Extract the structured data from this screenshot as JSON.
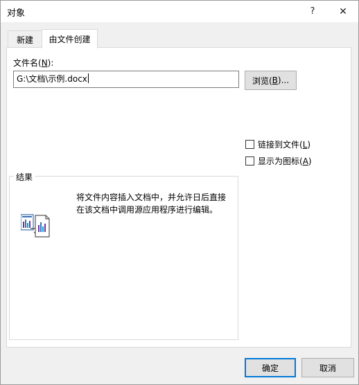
{
  "window": {
    "title": "对象",
    "help_glyph": "?",
    "close_glyph": "✕"
  },
  "tabs": [
    {
      "label": "新建",
      "selected": false
    },
    {
      "label": "由文件创建",
      "selected": true
    }
  ],
  "file": {
    "label_prefix": "文件名(",
    "label_key": "N",
    "label_suffix": "):",
    "value": "G:\\文档\\示例.docx",
    "browse_prefix": "浏览(",
    "browse_key": "B",
    "browse_suffix": ")..."
  },
  "options": {
    "link": {
      "prefix": "链接到文件(",
      "key": "L",
      "suffix": ")",
      "checked": false
    },
    "display_icon": {
      "prefix": "显示为图标(",
      "key": "A",
      "suffix": ")",
      "checked": false
    }
  },
  "result": {
    "title": "结果",
    "line1": "将文件内容插入文档中，并允许日后直接",
    "line2": "在该文档中调用源应用程序进行编辑。"
  },
  "footer": {
    "ok_label": "确定",
    "cancel_label": "取消"
  },
  "colors": {
    "accent": "#0078d7",
    "button_face": "#e1e1e1",
    "dialog_bg": "#f0f0f0"
  }
}
